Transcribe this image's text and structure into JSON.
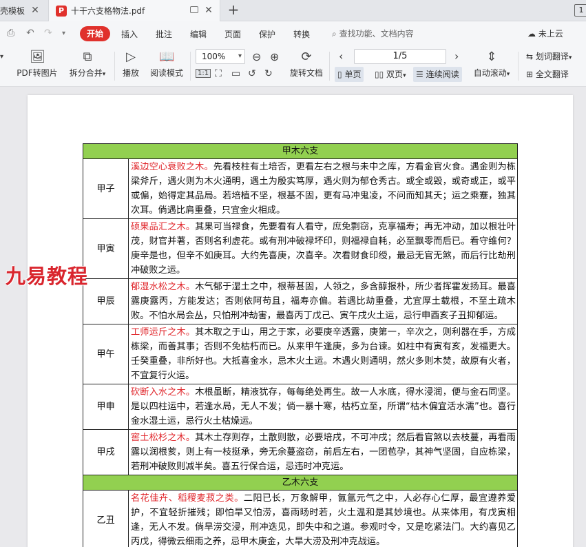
{
  "tabs": {
    "tab1_label": "壳模板",
    "tab2_label": "十干六支格物法.pdf",
    "close_glyph": "✕",
    "new_tab_glyph": "+",
    "window_btn": "1"
  },
  "menu": {
    "start": "开始",
    "items": [
      "插入",
      "批注",
      "编辑",
      "页面",
      "保护",
      "转换"
    ],
    "search_placeholder": "查找功能、文档内容",
    "cloud": "未上云"
  },
  "toolbar": {
    "pdf_to_image": "PDF转图片",
    "split_merge": "拆分合并",
    "play": "播放",
    "read_mode": "阅读模式",
    "zoom": "100%",
    "rotate": "旋转文档",
    "page_indicator": "1/5",
    "single_page": "单页",
    "double_page": "双页",
    "continuous": "连续阅读",
    "auto_scroll": "自动滚动",
    "word_translate": "划词翻译",
    "full_translate": "全文翻译",
    "actual_size": "1:1"
  },
  "watermark": "九易教程",
  "document": {
    "sections": [
      {
        "title": "甲木六支",
        "rows": [
          {
            "name": "甲子",
            "lead": "溪边空心衰败之木。",
            "text": "先看枝柱有土培否，更看左右之根与未中之库，方看金官火食。遇金则为栋梁斧斤，遇火则为木火通明，遇土为殷实笃厚，遇火则为郁仓秀古。或全或毁，或奇或正，或平或偏，始得定其品局。若培植不坚，根基不固，更有马冲鬼凌，不问而知其夭；运之乘蹇，独其次耳。倘遇比肩重叠，只宜金火相成。"
          },
          {
            "name": "甲寅",
            "lead": "硕果品汇之木。",
            "text": "其果可当禄食，先要看有人看守，庶免剽窃，克享福寿；再无冲动，加以根壮叶茂，财官并著，否则名利虚花。或有刑冲破禄坏印，则福禄自耗，必至飘零而后已。看守维何？庚辛是也，但辛不如庚耳。大约先喜庚，次喜辛。次看财食印绶，最忌无官无煞，而后行比劫刑冲破败之运。"
          },
          {
            "name": "甲辰",
            "lead": "郁湿水松之木。",
            "text": "木气郁于湿土之中，根蒂甚固，人领之，多含醇报朴，所少者挥霍发扬耳。最喜露庚露丙，方能发达；否则依阿苟且，福寿亦偏。若遇比劫重叠，尤宜厚土载根，不至土疏木败。不怕水局会丛，只怕刑冲劫害，最喜丙丁戊己、寅午戌火土运，忌行申酉亥子丑抑郁运。"
          },
          {
            "name": "甲午",
            "lead": "工师运斤之木。",
            "text": "其木取之于山，用之于家，必要庚辛透露，庚第一，辛次之，则利器在手，方成栋梁，而善其事；否则不免枯朽而已。从来甲午逢庚，多为台谏。如柱中有寅有亥，发福更大。壬癸重叠，非所好也。大抵喜金水，忌木火土运。木遇火则通明，然火多则木焚，故原有火者，不宜复行火运。"
          },
          {
            "name": "甲申",
            "lead": "砍断入水之木。",
            "text": "木根虽断，精液犹存，每每绝处再生。故一人水底，得水浸润，便与金石同坚。是以四柱运中，若逢水局，无人不发；倘一暴十寒，枯朽立至，所谓“枯木偏宜活水濡”也。喜行金水湿土运，忌行火土枯燥运。"
          },
          {
            "name": "甲戌",
            "lead": "窖土松杉之木。",
            "text": "其木土存则存，土散则散，必要培戌，不可冲戌；然后看官煞以去枝蔓，再看雨露以润根荄，则上有一枝挺承，旁无余蔓盗窃，前后左右，一团苞孕，其神气坚固，自应栋梁，若刑冲破败则减半矣。喜五行保合运，忌违时冲克运。"
          }
        ]
      },
      {
        "title": "乙木六支",
        "rows": [
          {
            "name": "乙丑",
            "lead": "名花佳卉、稻稷麦菽之类。",
            "text": "二阳已长，万象解甲，氤氲元气之中，人必存心仁厚，最宜遵养爱护，不宜轻折摧残；即怕旱又怕涝，喜雨旸时若，火土温和是其妙境也。从来体用，有戊寅相逢，无人不发。倘旱涝交浸，刑冲迭见，即失中和之道。参观时令，又是吃紧法门。大约喜见乙丙戊，得微云细雨之养，忌甲木庚金，大旱大涝及刑冲克战运。"
          }
        ]
      }
    ]
  }
}
